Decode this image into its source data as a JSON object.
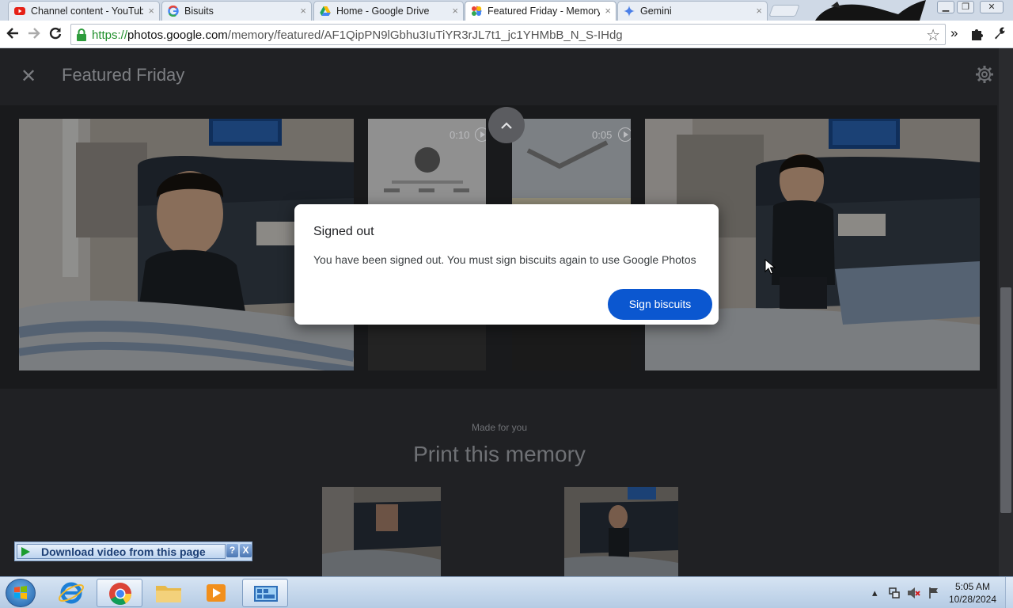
{
  "browser": {
    "tabs": [
      {
        "label": "Channel content - YouTube",
        "icon": "youtube-icon"
      },
      {
        "label": "Bisuits",
        "icon": "google-icon"
      },
      {
        "label": "Home - Google Drive",
        "icon": "drive-icon"
      },
      {
        "label": "Featured Friday - Memory",
        "icon": "photos-icon",
        "active": true
      },
      {
        "label": "Gemini",
        "icon": "gemini-icon"
      }
    ],
    "url": {
      "scheme": "https://",
      "host": "photos.google.com",
      "path": "/memory/featured/AF1QipPN9lGbhu3IuTiYR3rJL7t1_jc1YHMbB_N_S-IHdg"
    }
  },
  "page": {
    "title": "Featured Friday",
    "videos": [
      {
        "duration": "0:10"
      },
      {
        "duration": "0:05"
      }
    ],
    "made_for_you": "Made for you",
    "print_heading": "Print this memory"
  },
  "dialog": {
    "title": "Signed out",
    "body": "You have been signed out. You must sign biscuits again to use Google Photos",
    "button": "Sign biscuits"
  },
  "download_helper": {
    "label": "Download video from this page",
    "help": "?",
    "close": "X"
  },
  "taskbar": {
    "apps": [
      "internet-explorer-icon",
      "chrome-icon",
      "file-explorer-icon",
      "media-player-icon",
      "control-panel-icon"
    ],
    "time": "5:05 AM",
    "date": "10/28/2024"
  },
  "colors": {
    "page_background": "#202124",
    "dialog_button": "#0b57d0",
    "url_scheme": "#1f8f2b"
  }
}
